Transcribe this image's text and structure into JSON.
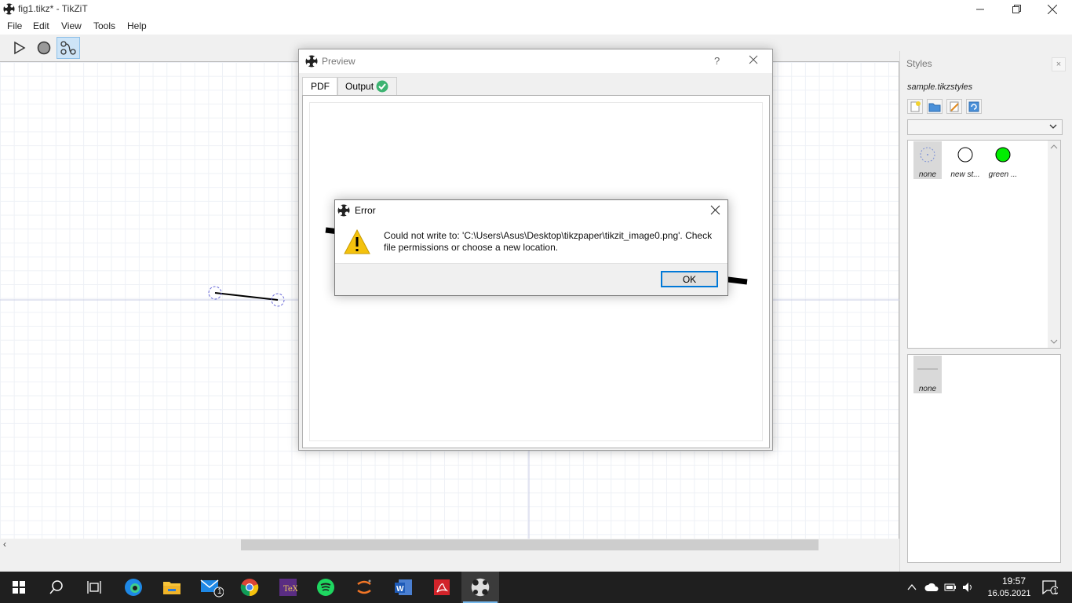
{
  "app": {
    "title": "fig1.tikz* - TikZiT",
    "menu": [
      "File",
      "Edit",
      "View",
      "Tools",
      "Help"
    ],
    "tools": [
      "select-tool",
      "vertex-tool",
      "edge-tool"
    ],
    "active_tool": "edge-tool"
  },
  "styles_panel": {
    "title": "Styles",
    "close_label": "×",
    "file_name": "sample.tikzstyles",
    "toolbar_buttons": [
      "new-style-icon",
      "open-folder-icon",
      "edit-pencil-icon",
      "refresh-icon"
    ],
    "selected_category": "",
    "node_styles": [
      {
        "label": "none",
        "fill": "#ffffff",
        "kind": "dashed",
        "selected": true
      },
      {
        "label": "new st...",
        "fill": "#ffffff",
        "kind": "circle",
        "selected": false
      },
      {
        "label": "green ...",
        "fill": "#00ee00",
        "kind": "circle",
        "selected": false
      }
    ],
    "edge_styles": [
      {
        "label": "none",
        "selected": true
      }
    ]
  },
  "preview": {
    "title": "Preview",
    "help_label": "?",
    "tabs": [
      {
        "label": "PDF",
        "active": true
      },
      {
        "label": "Output",
        "active": false,
        "status": "ok"
      }
    ]
  },
  "error_dialog": {
    "title": "Error",
    "message": "Could not write to: 'C:\\Users\\Asus\\Desktop\\tikzpaper\\tikzit_image0.png'. Check file permissions or choose a new location.",
    "ok_label": "OK"
  },
  "taskbar": {
    "apps": [
      "windows-start",
      "search",
      "task-view",
      "edge",
      "file-explorer",
      "mail",
      "chrome",
      "tex",
      "spotify",
      "jupyter",
      "word",
      "acrobat",
      "tikzit"
    ],
    "mail_badge": "1",
    "active_app": "tikzit",
    "time": "19:57",
    "date": "16.05.2021",
    "notification_count": "1"
  },
  "colors": {
    "accent": "#0078d7",
    "taskbar": "#1f1f1f",
    "active_tool": "#cde4f7",
    "warning": "#f4c20d",
    "ok_tab": "#3cb371"
  }
}
